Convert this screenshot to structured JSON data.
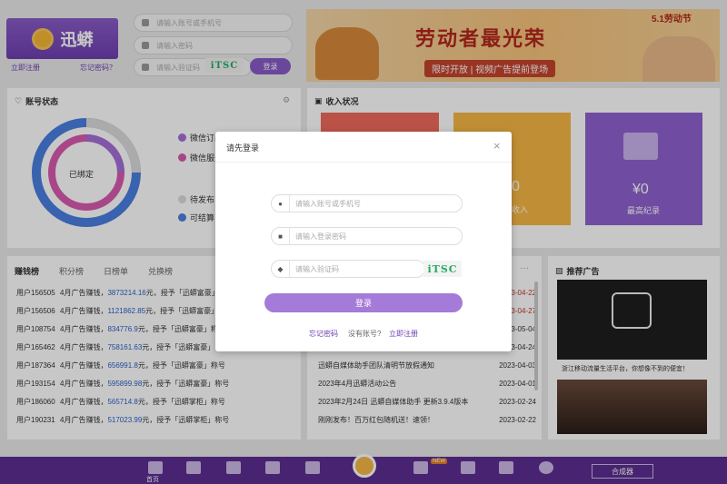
{
  "login": {
    "account_placeholder": "请输入账号或手机号",
    "password_placeholder": "请输入密码",
    "captcha_placeholder": "请输入验证码",
    "captcha_text": "iTSC",
    "login_button": "登录",
    "register_link": "立即注册",
    "forgot_link": "忘记密码？"
  },
  "brand": {
    "logo_text": "迅蟒"
  },
  "banner": {
    "headline": "劳动者最光荣",
    "sub": "限时开放 | 视频广告提前登场",
    "badge": "5.1劳动节"
  },
  "account_status": {
    "title": "账号状态",
    "center": "已绑定",
    "legend": [
      "微信订阅",
      "微信服务",
      "待发布",
      "可结算"
    ]
  },
  "income": {
    "title": "收入状况",
    "value": "¥0",
    "value2": "0",
    "label": "最高纪录",
    "label2": "收入"
  },
  "ranking": {
    "tabs": [
      "赚钱榜",
      "积分榜",
      "日榜单",
      "兑换榜"
    ],
    "rows": [
      {
        "user": "用户156505",
        "text": "4月广告赚钱",
        "amount": "3873214.16",
        "suffix": "元，授予「迅蟒富豪」"
      },
      {
        "user": "用户156506",
        "text": "4月广告赚钱",
        "amount": "1121862.85",
        "suffix": "元，授予「迅蟒富豪」"
      },
      {
        "user": "用户108754",
        "text": "4月广告赚钱",
        "amount": "834776.9",
        "suffix": "元，授予「迅蟒富豪」称号"
      },
      {
        "user": "用户165462",
        "text": "4月广告赚钱",
        "amount": "758161.63",
        "suffix": "元，授予「迅蟒富豪」"
      },
      {
        "user": "用户187364",
        "text": "4月广告赚钱",
        "amount": "656991.8",
        "suffix": "元，授予「迅蟒富豪」称号"
      },
      {
        "user": "用户193154",
        "text": "4月广告赚钱",
        "amount": "595899.98",
        "suffix": "元，授予「迅蟒富豪」称号"
      },
      {
        "user": "用户186060",
        "text": "4月广告赚钱",
        "amount": "565714.8",
        "suffix": "元，授予「迅蟒掌柜」称号"
      },
      {
        "user": "用户190231",
        "text": "4月广告赚钱",
        "amount": "517023.99",
        "suffix": "元，授予「迅蟒掌柜」称号"
      }
    ]
  },
  "news": {
    "rows": [
      {
        "title": "",
        "date": "2023-04-22"
      },
      {
        "title": "",
        "date": "2023-04-27"
      },
      {
        "title": "",
        "date": "2023-05-04"
      },
      {
        "title": "",
        "date": "2023-04-24"
      },
      {
        "title": "迅蟒自媒体助手团队清明节放假通知",
        "date": "2023-04-03"
      },
      {
        "title": "2023年4月迅蟒活动公告",
        "date": "2023-04-01"
      },
      {
        "title": "2023年2月24日 迅蟒自媒体助手 更新3.9.4版本",
        "date": "2023-02-24"
      },
      {
        "title": "刚刚发布！百万红包随机送！速领！",
        "date": "2023-02-22"
      }
    ]
  },
  "ads": {
    "title": "推荐广告",
    "caption": "浙江移动流量生活平台，你想像不到的便宜！"
  },
  "modal": {
    "title": "请先登录",
    "close": "×",
    "account_placeholder": "请输入账号或手机号",
    "password_placeholder": "请输入登录密码",
    "captcha_placeholder": "请输入验证码",
    "captcha_text": "iTSC",
    "login_button": "登录",
    "forgot": "忘记密码",
    "no_account": "没有账号?",
    "register": "立即注册"
  },
  "bottom": {
    "home": "首页",
    "new_badge": "NEW",
    "right_label": "合成器"
  },
  "colors": {
    "accent": "#6d3fb0",
    "button": "#a47bd8",
    "link_blue": "#2b62c6",
    "red_date": "#c0392b"
  }
}
